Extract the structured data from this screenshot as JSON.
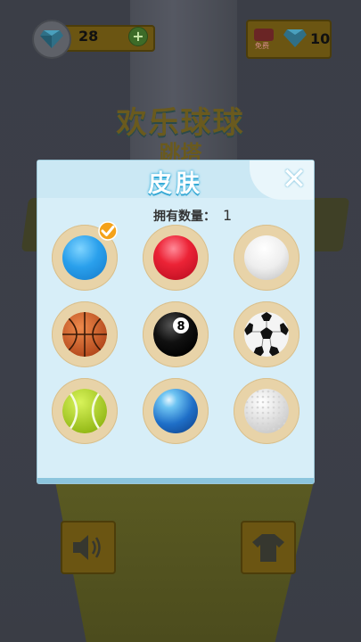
{
  "hud": {
    "gems_count": "28",
    "plus_label": "+",
    "free_label": "免费",
    "free_gems": "10"
  },
  "background": {
    "title": "欢乐球球",
    "subtitle": "跳塔"
  },
  "modal": {
    "title": "皮肤",
    "close_label": "✕",
    "owned_label": "拥有数量：",
    "owned_count": "1"
  },
  "skins": [
    {
      "name": "blue-ball",
      "selected": true
    },
    {
      "name": "red-ball",
      "selected": false
    },
    {
      "name": "white-ball",
      "selected": false
    },
    {
      "name": "basketball",
      "selected": false
    },
    {
      "name": "eight-ball",
      "selected": false
    },
    {
      "name": "soccer-ball",
      "selected": false
    },
    {
      "name": "tennis-ball",
      "selected": false
    },
    {
      "name": "glass-blue-ball",
      "selected": false
    },
    {
      "name": "golf-ball",
      "selected": false
    }
  ],
  "colors": {
    "modal_bg": "#d7eef8",
    "title_glow": "#41b6e0",
    "slot": "#e8d3a8"
  }
}
